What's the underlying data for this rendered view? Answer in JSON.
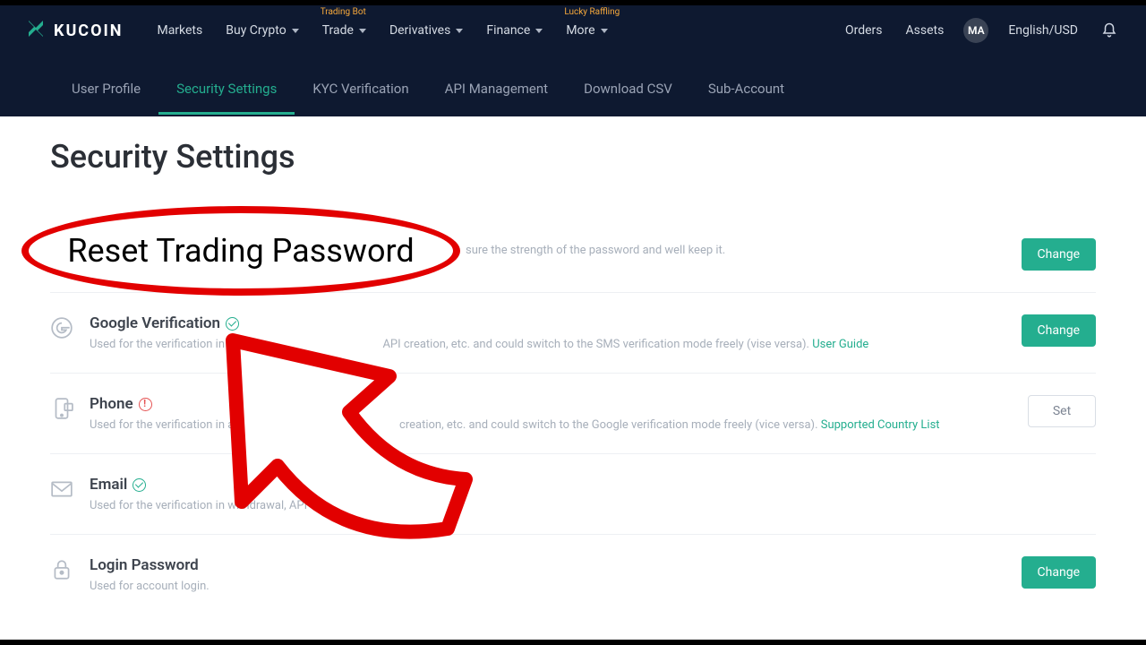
{
  "brand": "KUCOIN",
  "nav": {
    "markets": "Markets",
    "buy": "Buy Crypto",
    "trade": "Trade",
    "trade_badge": "Trading Bot",
    "derivatives": "Derivatives",
    "finance": "Finance",
    "more": "More",
    "more_badge": "Lucky Raffling"
  },
  "right": {
    "orders": "Orders",
    "assets": "Assets",
    "avatar": "MA",
    "locale": "English/USD"
  },
  "tabs": {
    "user_profile": "User Profile",
    "security_settings": "Security Settings",
    "kyc": "KYC Verification",
    "api": "API Management",
    "csv": "Download CSV",
    "sub": "Sub-Account"
  },
  "page_title": "Security Settings",
  "rows": {
    "r1": {
      "desc_tail": "sure the strength of the password and well keep it.",
      "action": "Change"
    },
    "google": {
      "title": "Google Verification",
      "desc": "Used for the verification in acco                                             API creation, etc. and could switch to the SMS verification mode freely (vise versa). ",
      "link": "User Guide",
      "action": "Change"
    },
    "phone": {
      "title": "Phone",
      "desc": "Used for the verification in account                                             creation, etc. and could switch to the Google verification mode freely (vice versa). ",
      "link": "Supported Country List",
      "action": "Set"
    },
    "email": {
      "title": "Email",
      "desc": "Used for the verification in withdrawal, API creation"
    },
    "login": {
      "title": "Login Password",
      "desc": "Used for account login.",
      "action": "Change"
    }
  },
  "annotation_text": "Reset Trading Password"
}
